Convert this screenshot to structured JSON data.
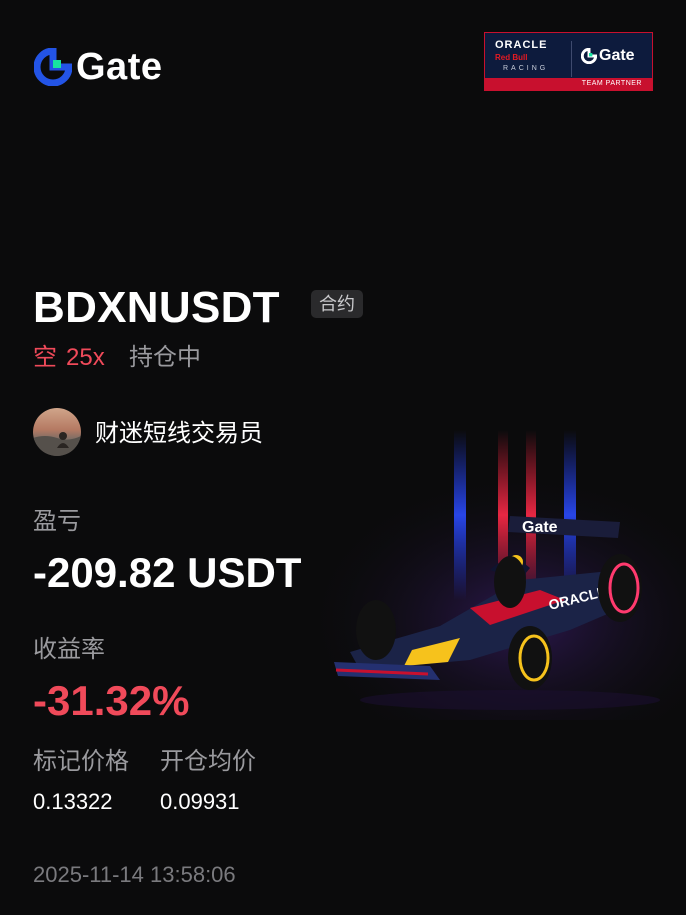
{
  "brand": {
    "name": "Gate",
    "icon": "gate-logo-icon"
  },
  "partner_badge": {
    "oracle": "ORACLE",
    "red_bull": "Red Bull",
    "racing": "RACING",
    "gate": "Gate",
    "footer": "TEAM PARTNER"
  },
  "position": {
    "symbol": "BDXNUSDT",
    "type_tag": "合约",
    "side": "空",
    "leverage": "25x",
    "status": "持仓中"
  },
  "trader": {
    "name": "财迷短线交易员"
  },
  "pnl": {
    "label": "盈亏",
    "value": "-209.82 USDT"
  },
  "roi": {
    "label": "收益率",
    "value": "-31.32%"
  },
  "prices": {
    "mark_label": "标记价格",
    "mark_value": "0.13322",
    "entry_label": "开仓均价",
    "entry_value": "0.09931"
  },
  "timestamp": "2025-11-14 13:58:06",
  "colors": {
    "negative": "#f04a5a",
    "background": "#0b0b0c",
    "muted": "#9a9a9e",
    "gate_blue": "#2354e6",
    "gate_green": "#17e6a1"
  }
}
